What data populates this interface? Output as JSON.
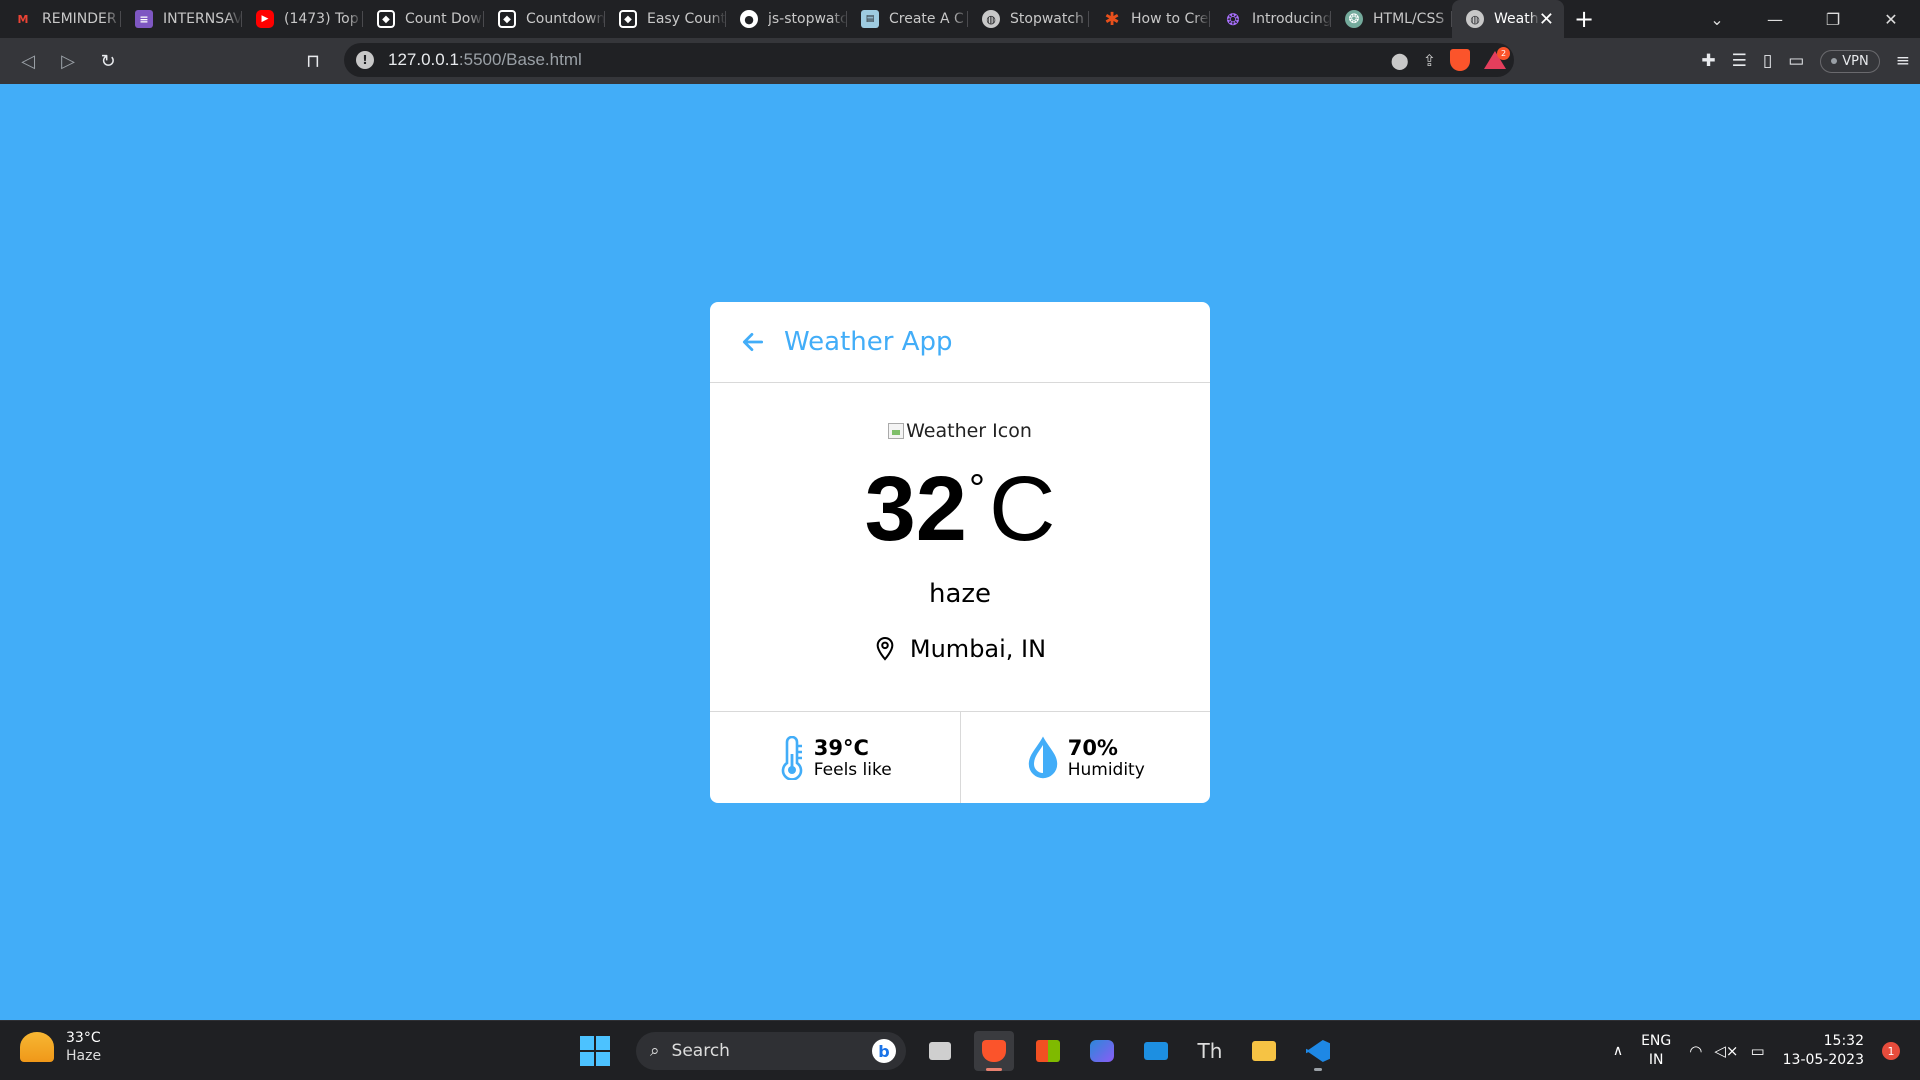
{
  "browser": {
    "tabs": [
      {
        "title": "REMINDER",
        "icon": "gmail-icon",
        "color": "#ea4335"
      },
      {
        "title": "INTERNSAV",
        "icon": "list-icon",
        "color": "#7e57c2"
      },
      {
        "title": "(1473) Top",
        "icon": "youtube-icon",
        "color": "#ff0000"
      },
      {
        "title": "Count Dow",
        "icon": "codepen-icon",
        "color": "#ffffff"
      },
      {
        "title": "Countdown",
        "icon": "codepen-icon",
        "color": "#ffffff"
      },
      {
        "title": "Easy Count",
        "icon": "codepen-icon",
        "color": "#ffffff"
      },
      {
        "title": "js-stopwatc",
        "icon": "github-icon",
        "color": "#ffffff"
      },
      {
        "title": "Create A C",
        "icon": "page-icon",
        "color": "#9ecbe0"
      },
      {
        "title": "Stopwatch",
        "icon": "globe-icon",
        "color": "#c8c8c8"
      },
      {
        "title": "How to Cre",
        "icon": "asterisk-icon",
        "color": "#e8501c"
      },
      {
        "title": "Introducing",
        "icon": "openai-icon",
        "color": "#a970ff"
      },
      {
        "title": "HTML/CSS",
        "icon": "openai-icon",
        "color": "#74aa9c"
      }
    ],
    "active_tab": {
      "title": "Weathe",
      "icon": "globe-icon"
    },
    "url_host": "127.0.0.1",
    "url_rest": ":5500/Base.html",
    "vpn_label": "VPN",
    "brave_badge": "2"
  },
  "weather": {
    "title": "Weather App",
    "icon_alt": "Weather Icon",
    "temp_value": "32",
    "temp_deg": "°",
    "temp_unit": "C",
    "description": "haze",
    "location": "Mumbai, IN",
    "feels_like_value": "39°C",
    "feels_like_label": "Feels like",
    "humidity_value": "70%",
    "humidity_label": "Humidity",
    "accent_color": "#42adf8"
  },
  "taskbar": {
    "weather_temp": "33°C",
    "weather_desc": "Haze",
    "search_label": "Search",
    "lang_top": "ENG",
    "lang_bottom": "IN",
    "time": "15:32",
    "date": "13-05-2023",
    "notification_count": "1"
  }
}
